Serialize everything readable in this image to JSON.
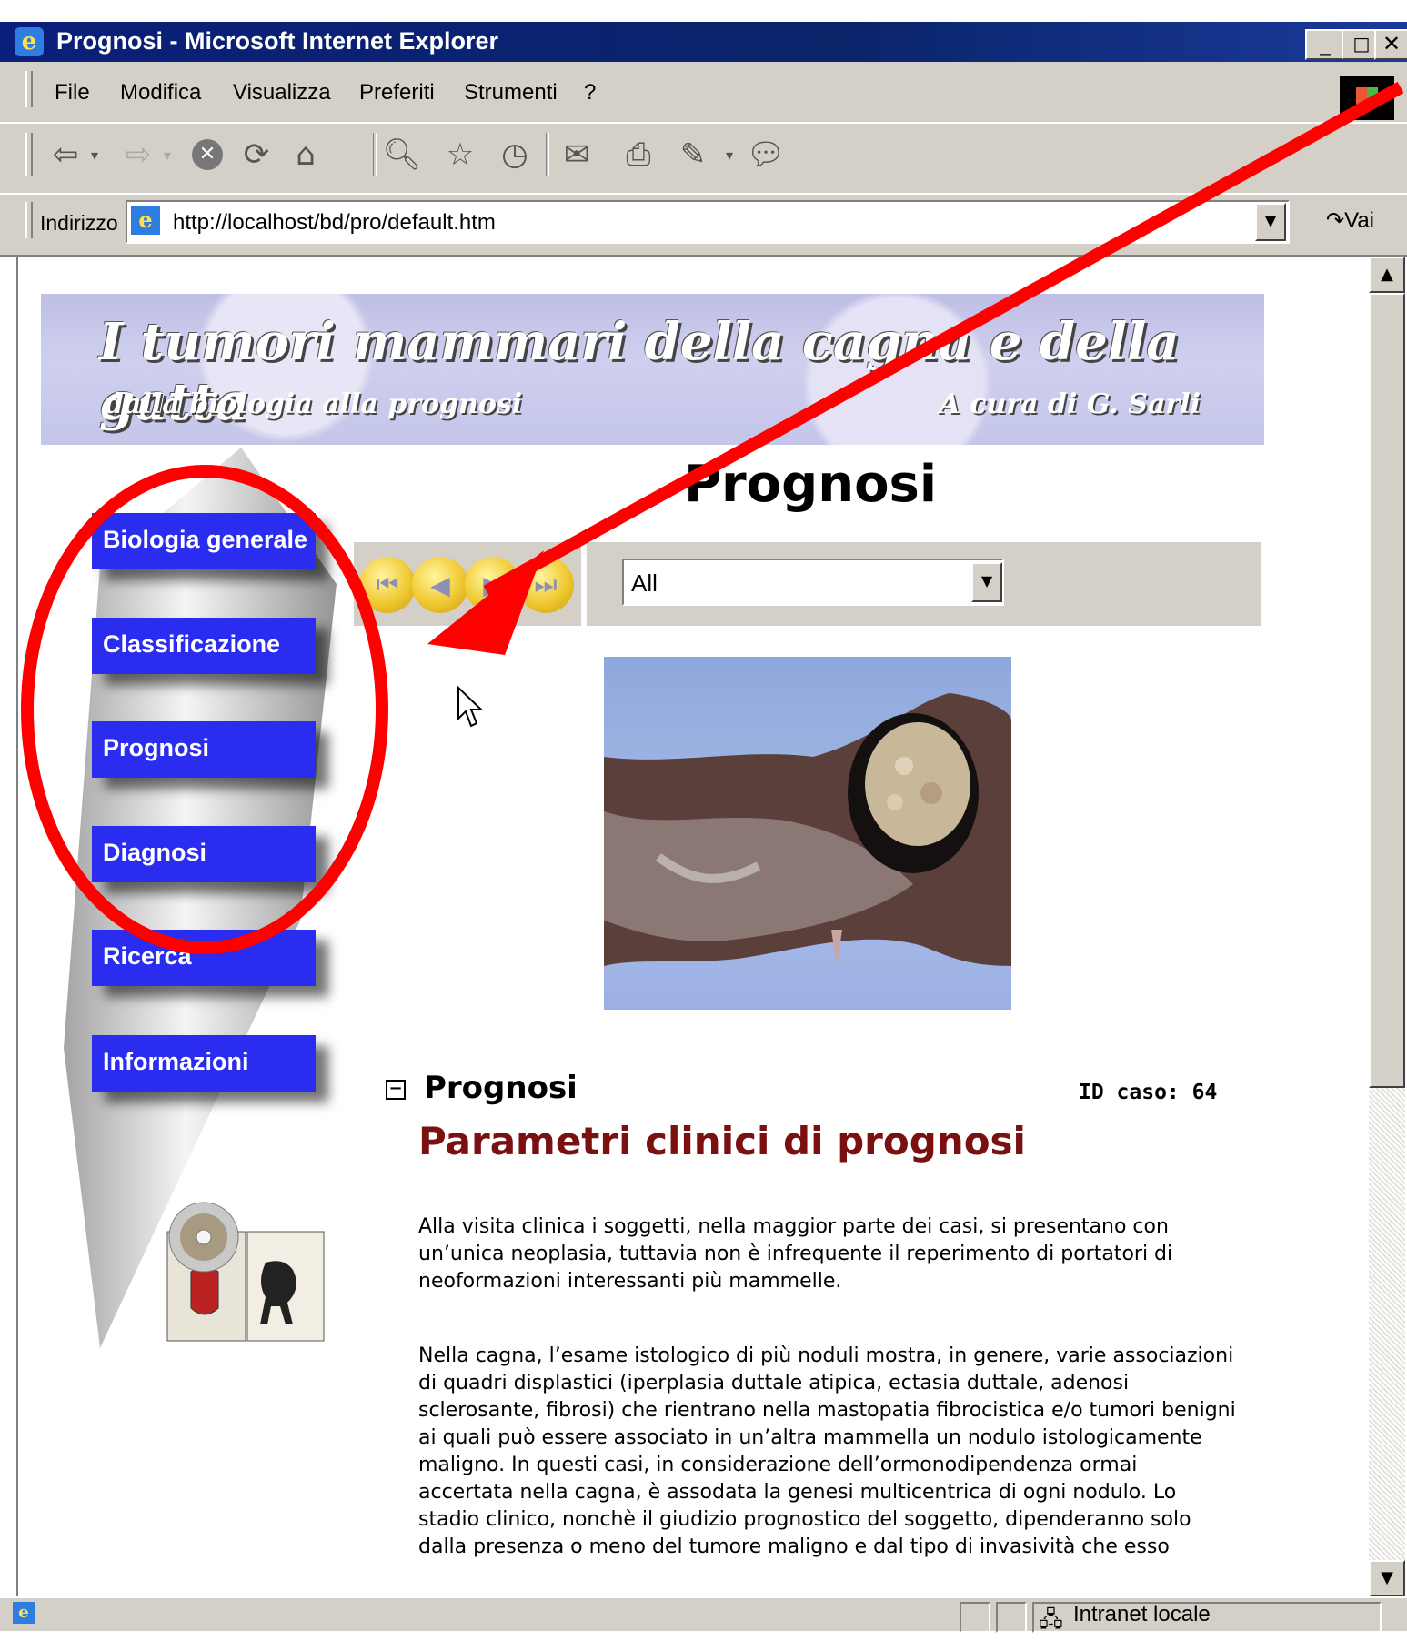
{
  "window": {
    "title": "Prognosi - Microsoft Internet Explorer"
  },
  "menu": [
    "File",
    "Modifica",
    "Visualizza",
    "Preferiti",
    "Strumenti",
    "?"
  ],
  "address": {
    "label": "Indirizzo",
    "url": "http://localhost/bd/pro/default.htm",
    "go_label": "Vai"
  },
  "banner": {
    "title": "I tumori mammari della cagna e della gatta",
    "subtitle": "dalla biologia alla prognosi",
    "credit": "A cura di G. Sarli"
  },
  "nav": [
    "Biologia generale",
    "Classificazione",
    "Prognosi",
    "Diagnosi",
    "Ricerca",
    "Informazioni"
  ],
  "page": {
    "title": "Prognosi",
    "filter_value": "All",
    "section": "Prognosi",
    "case_id": "ID caso: 64",
    "heading": "Parametri clinici di prognosi",
    "paragraphs": [
      "Alla visita clinica i soggetti, nella maggior parte dei casi, si presentano con un’unica neoplasia, tuttavia non è infrequente il reperimento di portatori di neoformazioni interessanti più mammelle.",
      "Nella cagna, l’esame istologico di più noduli mostra, in genere, varie associazioni di quadri displastici (iperplasia duttale atipica, ectasia duttale, adenosi sclerosante, fibrosi) che rientrano nella mastopatia fibrocistica e/o tumori benigni ai quali può essere associato in un’altra mammella un nodulo istologicamente maligno. In questi casi, in considerazione dell’ormonodipendenza ormai accertata nella cagna, è assodata la genesi multicentrica di ogni nodulo. Lo stadio clinico, nonchè il giudizio prognostico del soggetto, dipenderanno solo dalla presenza o meno del tumore maligno e dal tipo di invasività che esso"
    ]
  },
  "status": {
    "zone": "Intranet locale"
  },
  "colors": {
    "title_bar": "#0a246a",
    "nav_button": "#2a2cf0",
    "heading": "#7a1010",
    "annotation": "#ff0000"
  }
}
